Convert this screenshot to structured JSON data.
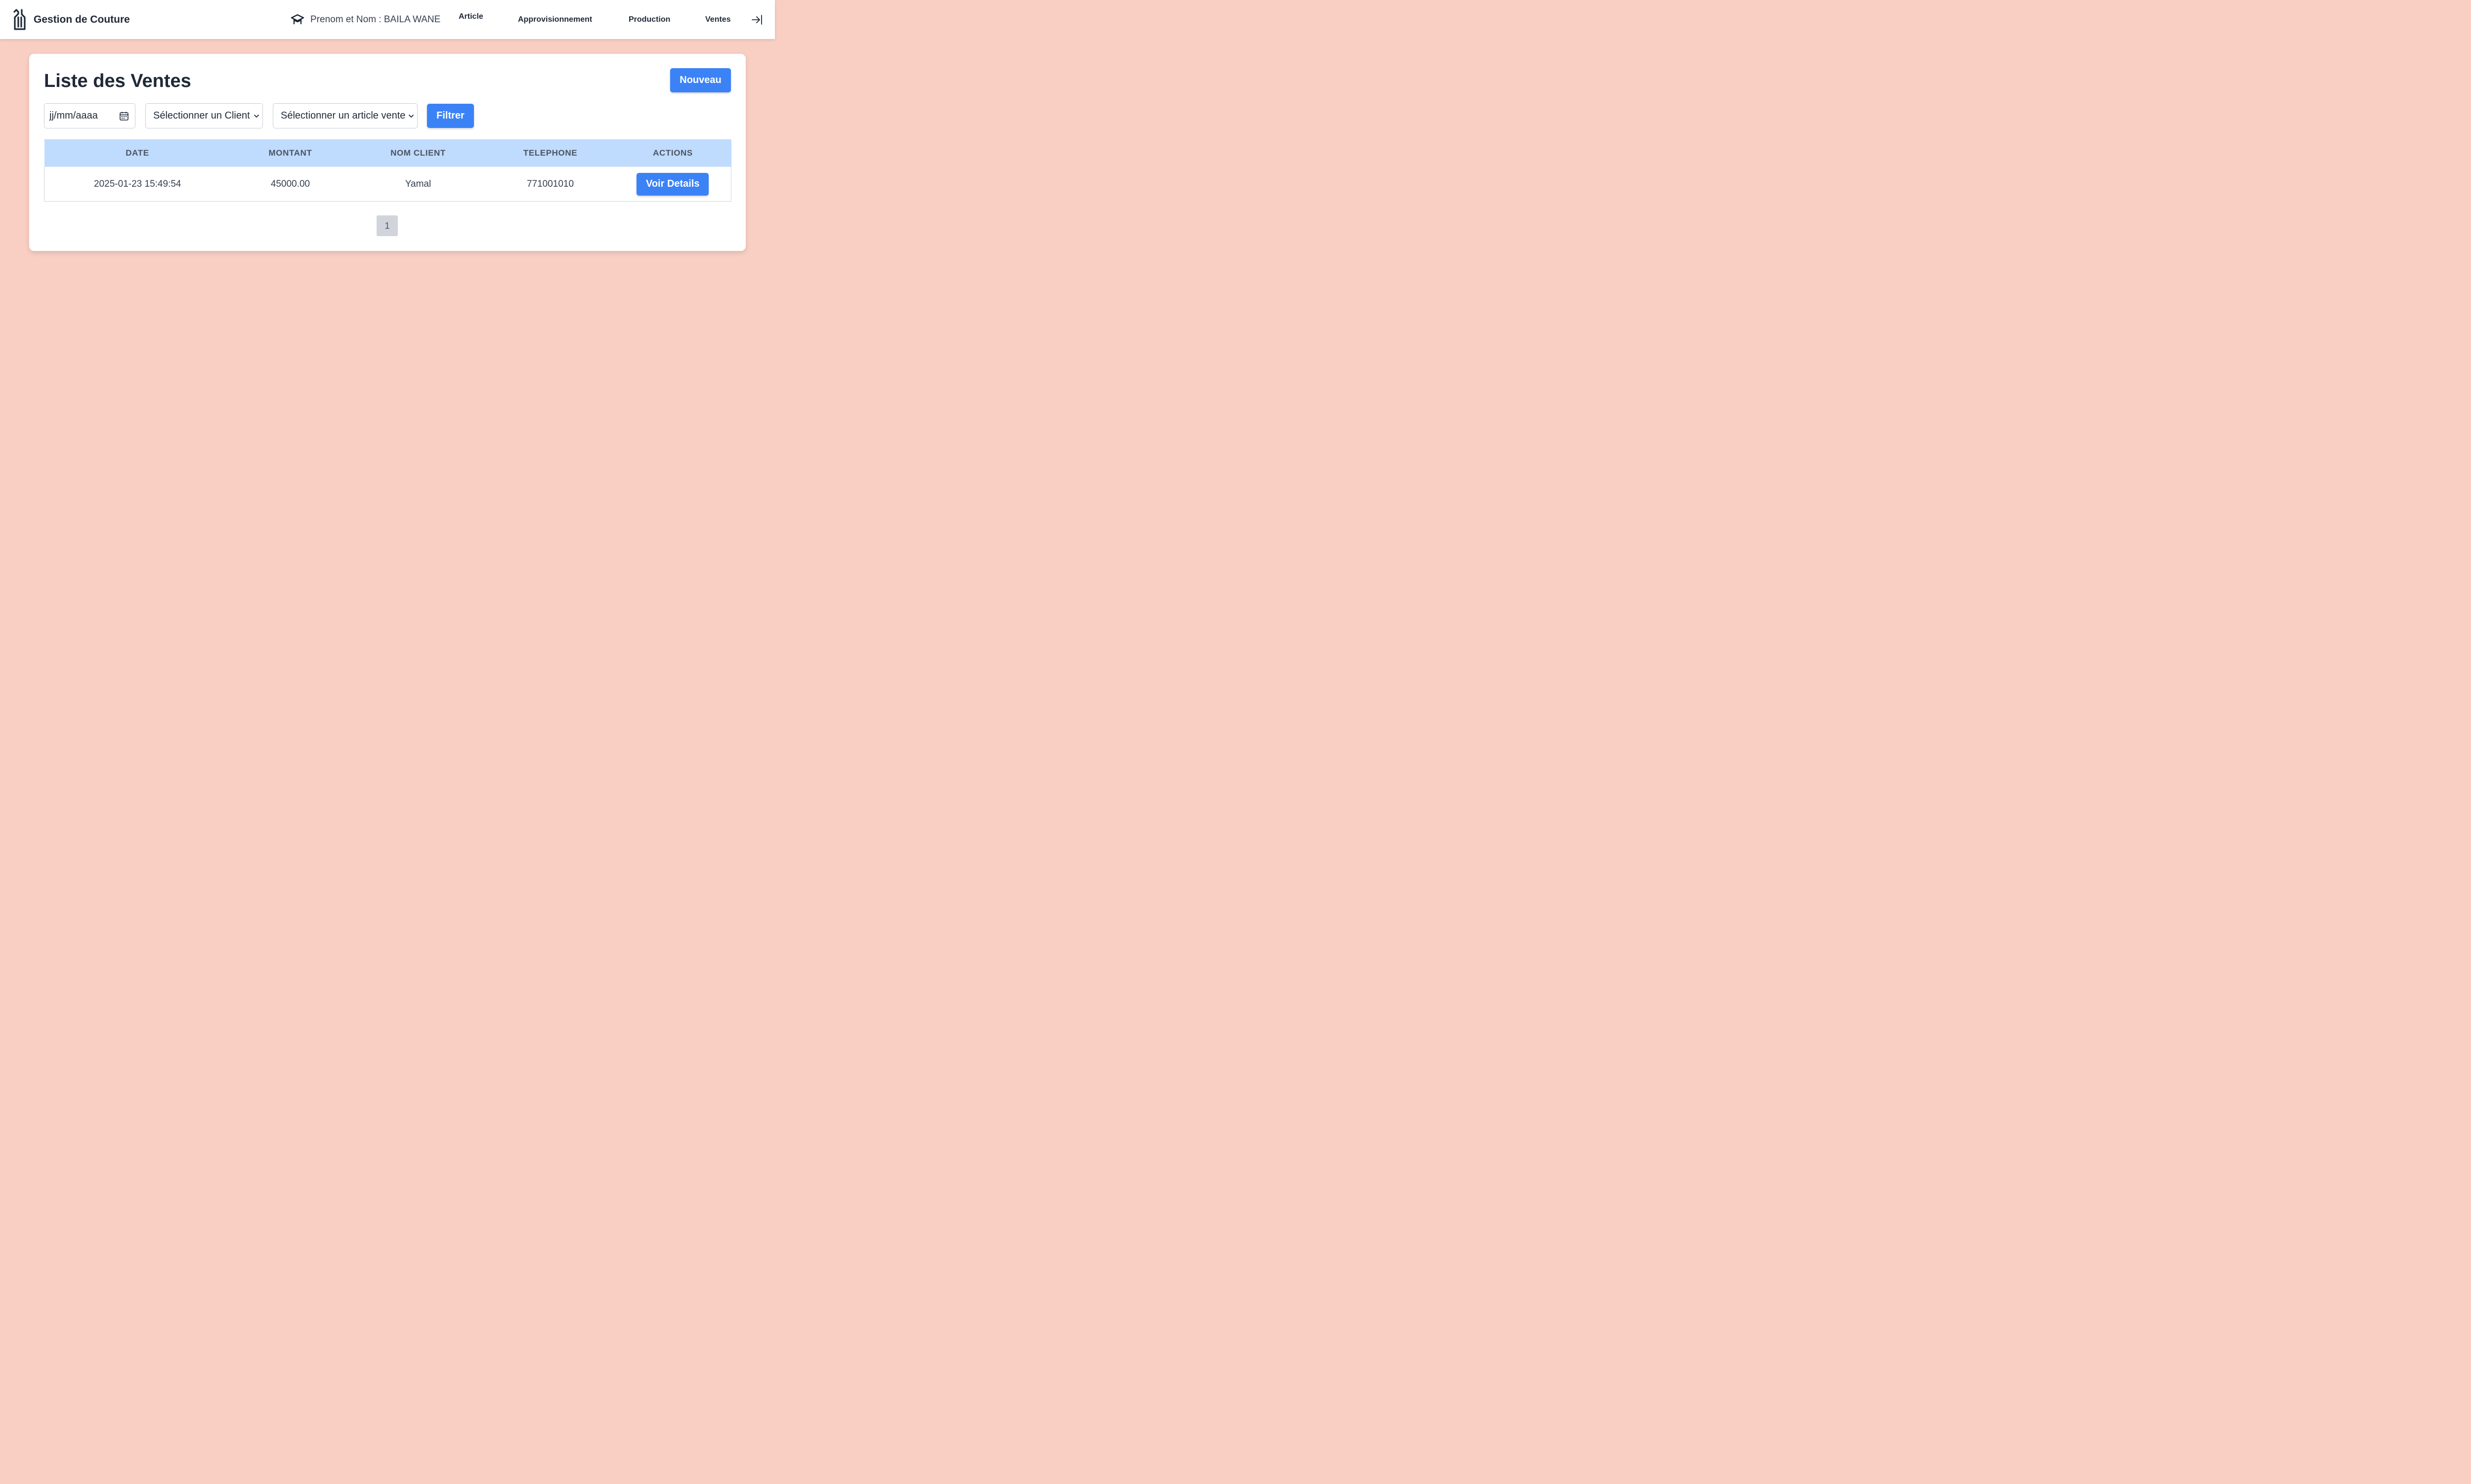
{
  "navbar": {
    "brand_title": "Gestion de Couture",
    "brand_icon": "tailor-logo-icon",
    "user_icon": "graduation-cap-icon",
    "user_label": "Prenom et Nom : BAILA WANE",
    "links": {
      "article": "Article",
      "approvisionnement": "Approvisionnement",
      "production": "Production",
      "ventes": "Ventes"
    },
    "logout_icon": "logout-icon"
  },
  "page": {
    "title": "Liste des Ventes",
    "new_button": "Nouveau"
  },
  "filters": {
    "date_placeholder": "jj/mm/aaaa",
    "client_select": "Sélectionner un Client",
    "article_select": "Sélectionner un article vente",
    "filter_button": "Filtrer"
  },
  "table": {
    "headers": {
      "date": "DATE",
      "montant": "MONTANT",
      "nom_client": "NOM CLIENT",
      "telephone": "TELEPHONE",
      "actions": "ACTIONS"
    },
    "rows": [
      {
        "date": "2025-01-23 15:49:54",
        "montant": "45000.00",
        "nom_client": "Yamal",
        "telephone": "771001010",
        "action_label": "Voir Details"
      }
    ]
  },
  "pagination": {
    "current": "1"
  },
  "colors": {
    "background": "#f9cfc3",
    "primary": "#3b82f6",
    "table_header": "#bfdbfe"
  }
}
